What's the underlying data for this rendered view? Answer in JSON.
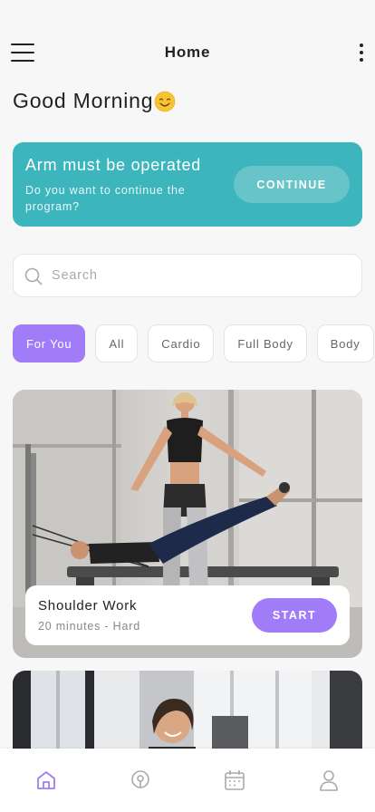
{
  "header": {
    "title": "Home",
    "menu_icon": "hamburger-menu-icon",
    "more_icon": "vertical-dots-icon"
  },
  "greeting": {
    "text": "Good Morning",
    "emoji_icon": "smiling-face-emoji"
  },
  "banner": {
    "title": "Arm must be operated",
    "subtitle": "Do you want to continue the program?",
    "button_label": "CONTINUE",
    "color": "#3db5bc"
  },
  "search": {
    "placeholder": "Search",
    "value": "",
    "icon": "search-icon"
  },
  "categories": {
    "items": [
      {
        "label": "For You",
        "active": true
      },
      {
        "label": "All",
        "active": false
      },
      {
        "label": "Cardio",
        "active": false
      },
      {
        "label": "Full Body",
        "active": false
      },
      {
        "label": "Body",
        "active": false
      }
    ],
    "accent": "#a07cf8"
  },
  "workouts": [
    {
      "title": "Shoulder Work",
      "meta": "20 minutes - Hard",
      "button_label": "START",
      "image": "pilates-reformer-photo"
    },
    {
      "image": "gym-woman-smiling-photo"
    }
  ],
  "bottom_nav": {
    "items": [
      {
        "icon": "home-icon",
        "active": true
      },
      {
        "icon": "location-pin-icon",
        "active": false
      },
      {
        "icon": "calendar-icon",
        "active": false
      },
      {
        "icon": "profile-icon",
        "active": false
      }
    ],
    "active_color": "#a07cf8",
    "inactive_color": "#aaaaaa"
  }
}
